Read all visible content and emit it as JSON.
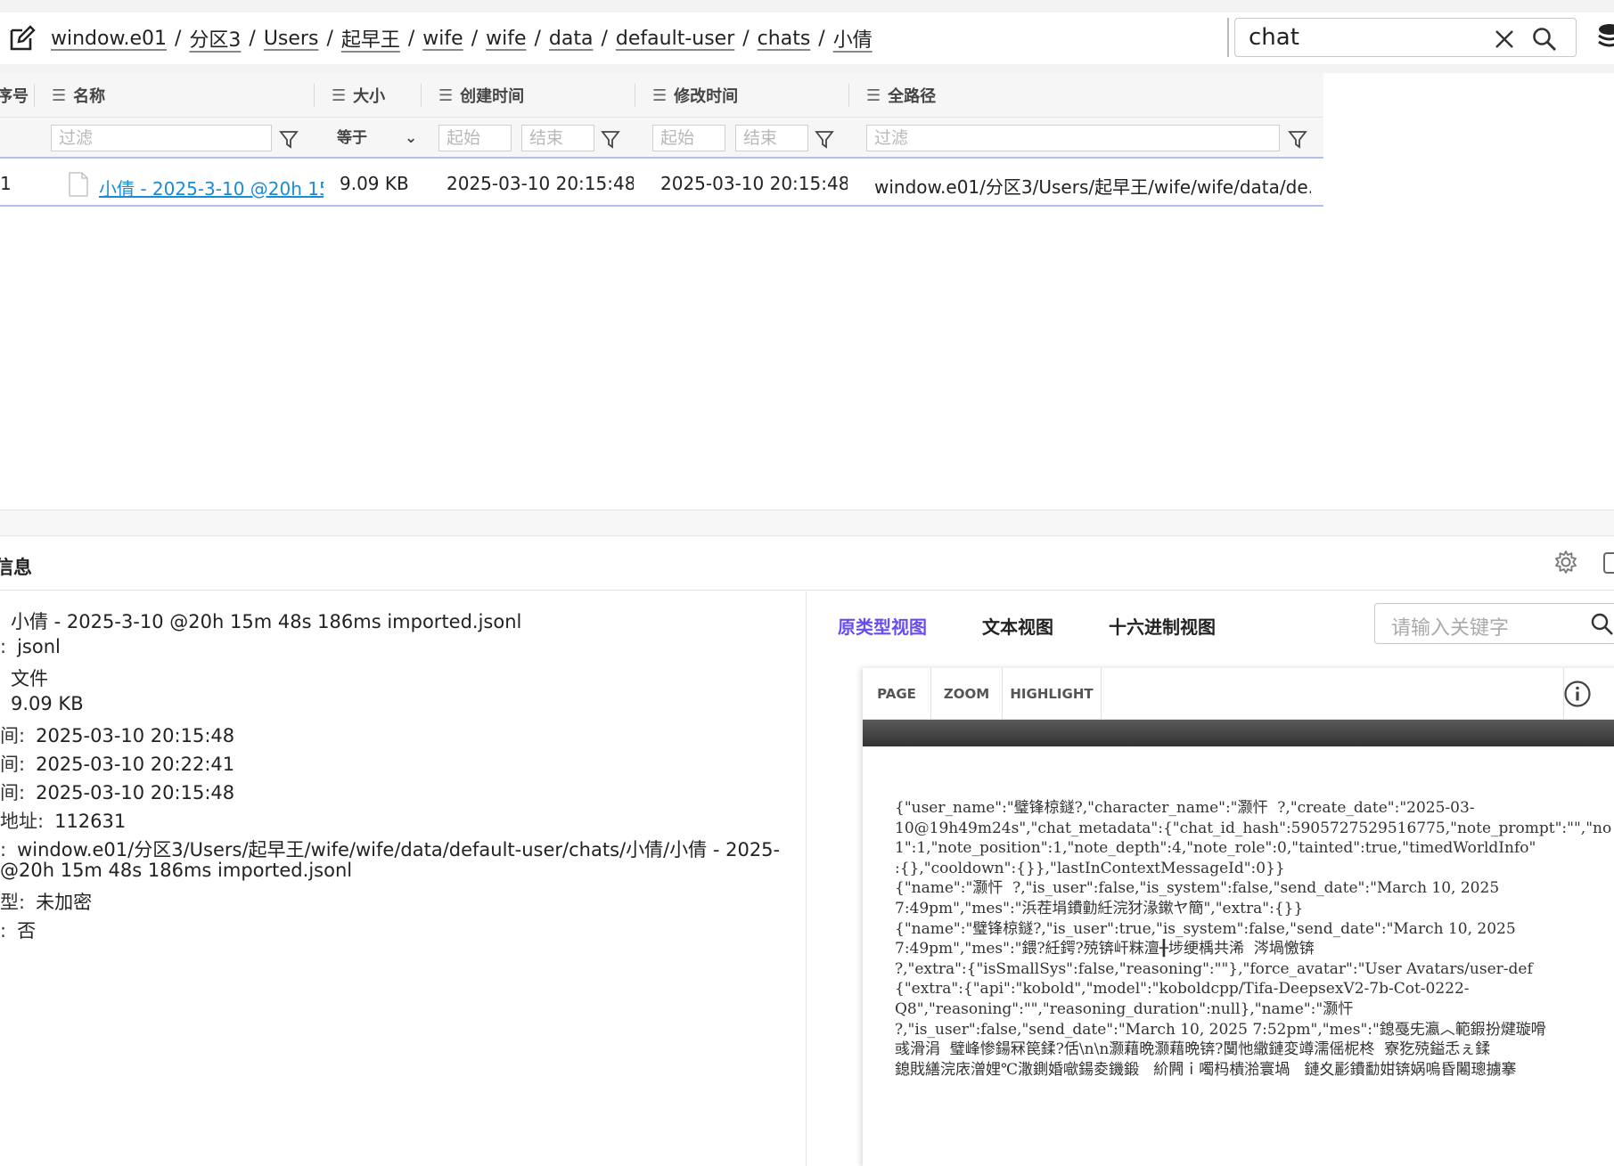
{
  "path_bar": {
    "crumbs": [
      "window.e01",
      "分区3",
      "Users",
      "起早王",
      "wife",
      "wife",
      "data",
      "default-user",
      "chats",
      "小倩"
    ],
    "separator": "/"
  },
  "search": {
    "value": "chat"
  },
  "table": {
    "columns": [
      "序号",
      "名称",
      "大小",
      "创建时间",
      "修改时间",
      "全路径"
    ],
    "filters": {
      "name_placeholder": "过滤",
      "size_op": "等于",
      "created_start": "起始",
      "created_end": "结束",
      "modified_start": "起始",
      "modified_end": "结束",
      "path_placeholder": "过滤"
    },
    "rows": [
      {
        "index": "1",
        "name": "小倩 - 2025-3-10 @20h 15m 48s 186ms imported.jsonl",
        "size": "9.09 KB",
        "created": "2025-03-10 20:15:48",
        "modified": "2025-03-10 20:15:48",
        "path": "window.e01/分区3/Users/起早王/wife/wife/data/de..."
      }
    ]
  },
  "info_panel": {
    "title": "信息",
    "rows": [
      {
        "k": "",
        "v": "小倩 - 2025-3-10 @20h 15m 48s 186ms imported.jsonl"
      },
      {
        "k": ":",
        "v": "jsonl"
      },
      {
        "k": "",
        "v": "文件"
      },
      {
        "k": "",
        "v": "9.09 KB"
      },
      {
        "k": "间:",
        "v": "2025-03-10 20:15:48"
      },
      {
        "k": "间:",
        "v": "2025-03-10 20:22:41"
      },
      {
        "k": "间:",
        "v": "2025-03-10 20:15:48"
      },
      {
        "k": "地址:",
        "v": "112631"
      },
      {
        "k": ":",
        "v": "window.e01/分区3/Users/起早王/wife/wife/data/default-user/chats/小倩/小倩 - 2025-"
      },
      {
        "k": "",
        "v": "@20h 15m 48s 186ms imported.jsonl"
      },
      {
        "k": "型:",
        "v": "未加密"
      },
      {
        "k": ":",
        "v": "否"
      }
    ]
  },
  "preview": {
    "tabs": [
      "原类型视图",
      "文本视图",
      "十六进制视图"
    ],
    "keyword_placeholder": "请输入关键字",
    "toolbar": [
      "PAGE",
      "ZOOM",
      "HIGHLIGHT"
    ],
    "lines": [
      "{\"user_name\":\"璧锋椋鐩?,\"character_name\":\"灏忓  ?,\"create_date\":\"2025-03-",
      "10@19h49m24s\",\"chat_metadata\":{\"chat_id_hash\":5905727529516775,\"note_prompt\":\"\",\"no",
      "1\":1,\"note_position\":1,\"note_depth\":4,\"note_role\":0,\"tainted\":true,\"timedWorldInfo\"",
      ":{},\"cooldown\":{}},\"lastInContextMessageId\":0}}",
      "{\"name\":\"灏忓  ?,\"is_user\":false,\"is_system\":false,\"send_date\":\"March 10, 2025",
      "7:49pm\",\"mes\":\"浜茬埍鐨勭紝浣犲湪鏉ヤ簡\",\"extra\":{}}",
      "{\"name\":\"璧锋椋鐩?,\"is_user\":true,\"is_system\":false,\"send_date\":\"March 10, 2025",
      "7:49pm\",\"mes\":\"鍡?紝鍔?殑锛屽粖澶╂埗绠楀共浠  涔堝憿锛",
      "?,\"extra\":{\"isSmallSys\":false,\"reasoning\":\"\"},\"force_avatar\":\"User Avatars/user-def",
      "{\"extra\":{\"api\":\"kobold\",\"model\":\"koboldcpp/Tifa-DeepsexV2-7b-Cot-0222-",
      "Q8\",\"reasoning\":\"\",\"reasoning_duration\":null},\"name\":\"灏忓",
      "?,\"is_user\":false,\"send_date\":\"March 10, 2025 7:52pm\",\"mes\":\"鎴戞兂瀛︿範鍜扮煡璇嗗",
      "彧滑涓  璧峰惨鍚冧笢鍒?佸\\n\\n灏藉晩灏藉晩锛?闅忚繖鏈変竴濡傜柅柊  寮犵殑鎰忎ぇ鍒",
      "鎴戝繕浣庡潧娌℃潵鍘婚噷鍚夌鐖鍛   紒闁ｉ噣杩樻湁寰堝   鏈夊彲鐨勫姏锛娲嗚昏闂璁擄搴"
    ]
  }
}
